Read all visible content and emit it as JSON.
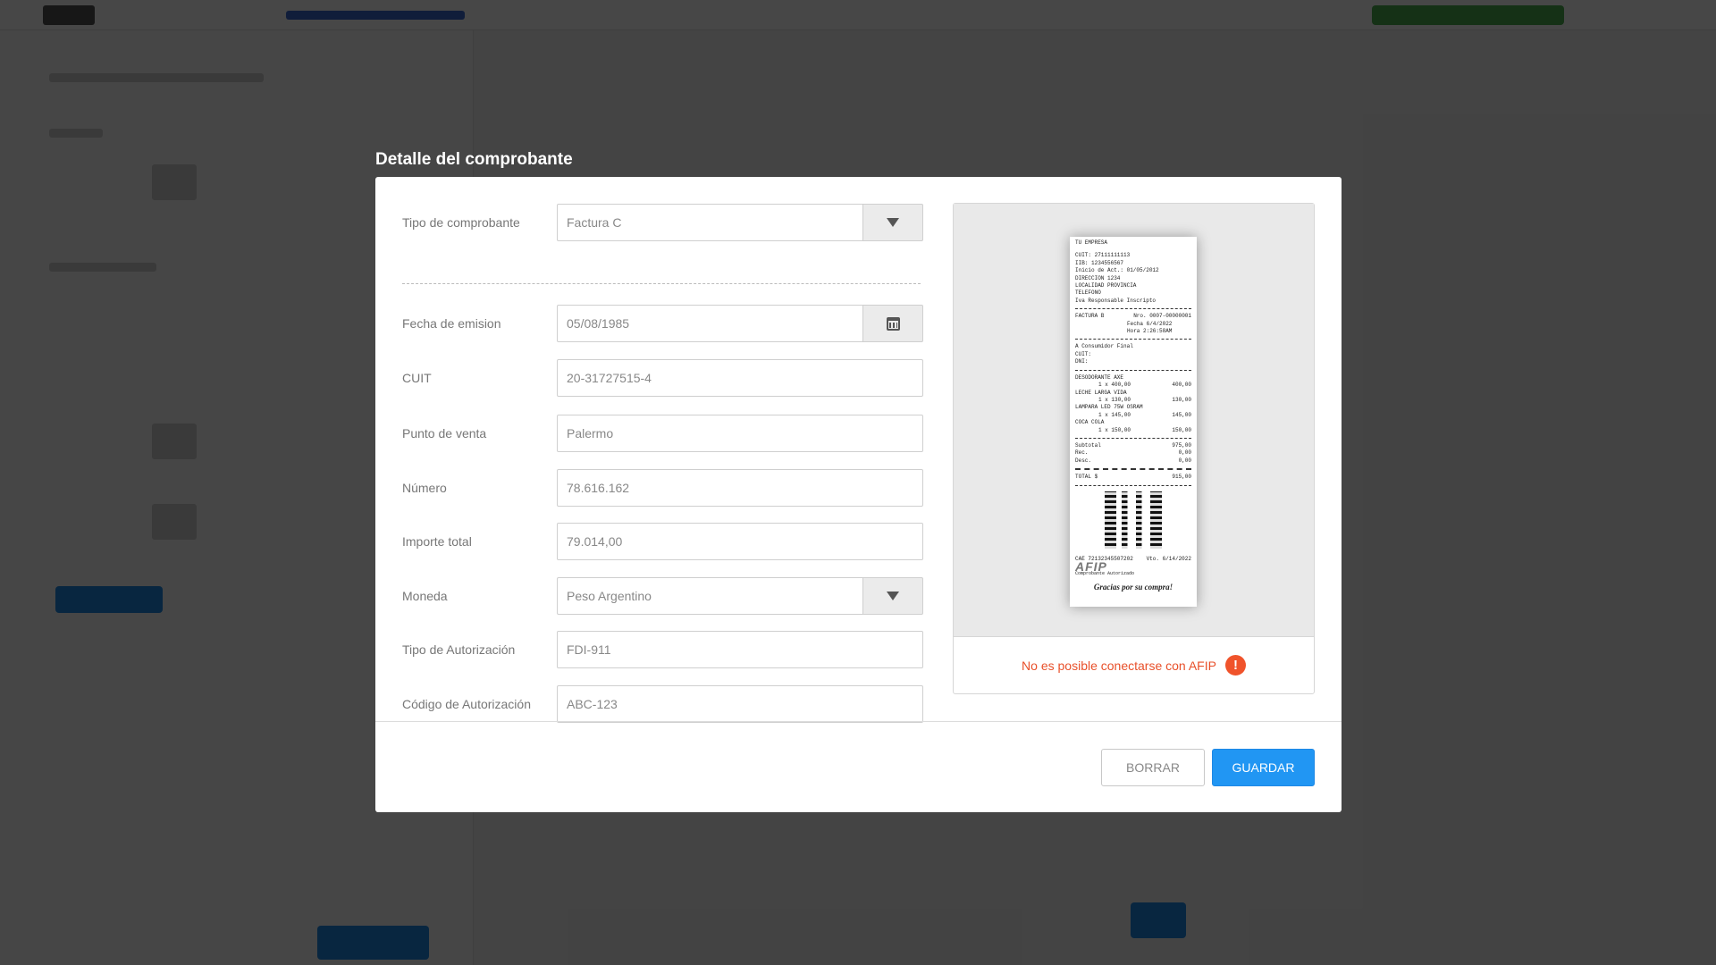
{
  "modal": {
    "title": "Detalle del comprobante"
  },
  "form": {
    "tipo_comprobante": {
      "label": "Tipo de comprobante",
      "value": "Factura C"
    },
    "fecha_emision": {
      "label": "Fecha de emision",
      "value": "05/08/1985"
    },
    "cuit": {
      "label": "CUIT",
      "value": "20-31727515-4"
    },
    "punto_venta": {
      "label": "Punto de venta",
      "value": "Palermo"
    },
    "numero": {
      "label": "Número",
      "value": "78.616.162"
    },
    "importe_total": {
      "label": "Importe total",
      "value": "79.014,00"
    },
    "moneda": {
      "label": "Moneda",
      "value": "Peso Argentino"
    },
    "tipo_autorizacion": {
      "label": "Tipo de Autorización",
      "value": "FDI-911"
    },
    "codigo_autorizacion": {
      "label": "Código de Autorización",
      "value": "ABC-123"
    }
  },
  "receipt": {
    "company": "TU EMPRESA",
    "cuit": "CUIT:  27111111113",
    "iib": "IIB:   1234556567",
    "inicio": "Inicio de Act.:   01/05/2012",
    "direccion": "DIRECCION 1234",
    "localidad": "LOCALIDAD PROVINCIA",
    "telefono": "TELEFONO",
    "iva": "Iva Responsable Inscripto",
    "factura": "FACTURA B",
    "nro": "Nro.   0007-00000001",
    "fecha": "Fecha    6/4/2022",
    "hora": "Hora    2:26:58AM",
    "consumidor": "A Consumidor Final",
    "cuit2": "CUIT:",
    "dni": "DNI:",
    "item1": "DESODORANTE AXE",
    "item1_qty": "1  x   400,00",
    "item1_total": "400,00",
    "item2": "LECHE LARGA VIDA",
    "item2_qty": "1  x   130,00",
    "item2_total": "130,00",
    "item3": "LAMPARA LED 75W OSRAM",
    "item3_qty": "1  x   145,00",
    "item3_total": "145,00",
    "item4": "COCA COLA",
    "item4_qty": "1  x   150,00",
    "item4_total": "150,00",
    "subtotal_label": "Subtotal",
    "subtotal": "975,00",
    "rec_label": "Rec.",
    "rec": "0,00",
    "desc_label": "Desc.",
    "desc": "0,00",
    "total_label": "TOTAL   $",
    "total": "915,00",
    "cae": "CAE 72132345507202",
    "vto": "Vto.  6/14/2022",
    "afip": "AFIP",
    "autorizado": "Comprobante Autorizado",
    "thanks": "Gracias por su compra!"
  },
  "warning": {
    "text": "No es posible conectarse con AFIP",
    "icon": "!"
  },
  "buttons": {
    "borrar": "BORRAR",
    "guardar": "GUARDAR"
  },
  "colors": {
    "primary": "#2196f3",
    "warning": "#f0532b"
  }
}
